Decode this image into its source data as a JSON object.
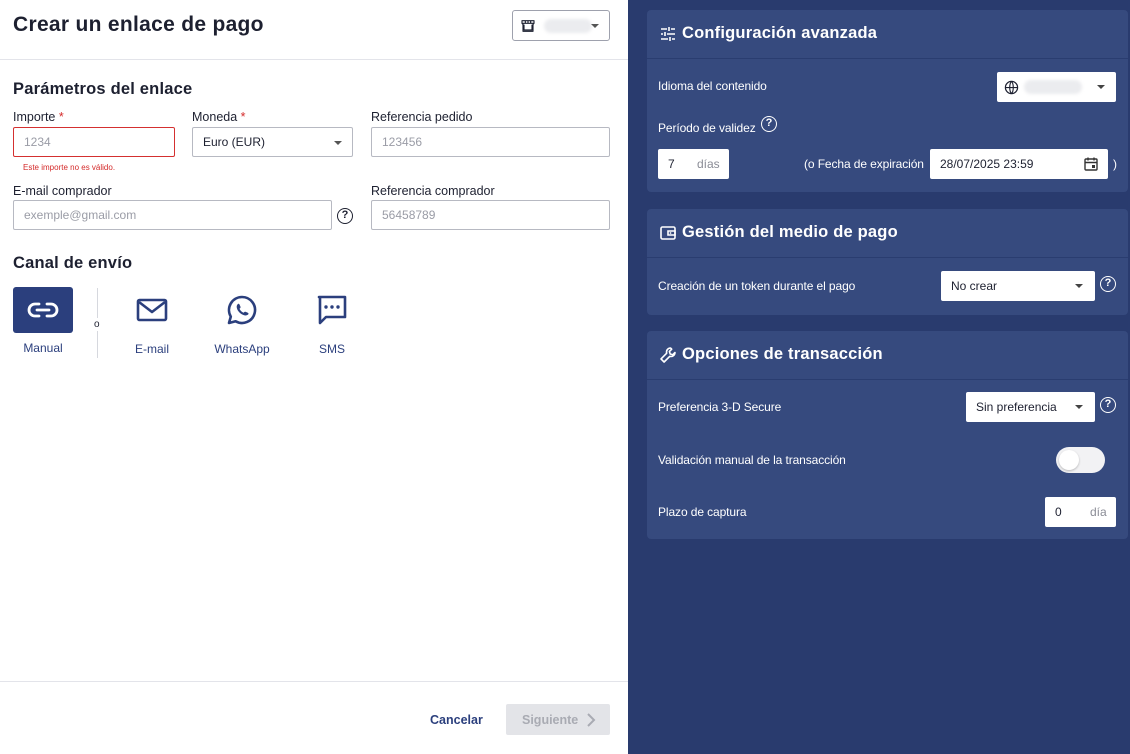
{
  "header": {
    "title": "Crear un enlace de pago",
    "shop_selector_value": "••••"
  },
  "params": {
    "title": "Parámetros del enlace",
    "amount": {
      "label": "Importe",
      "required": "*",
      "placeholder": "1234",
      "error": "Este importe no es válido."
    },
    "currency": {
      "label": "Moneda",
      "required": "*",
      "value": "Euro (EUR)"
    },
    "order_ref": {
      "label": "Referencia pedido",
      "placeholder": "123456"
    },
    "email": {
      "label": "E-mail comprador",
      "placeholder": "exemple@gmail.com"
    },
    "buyer_ref": {
      "label": "Referencia comprador",
      "placeholder": "56458789"
    }
  },
  "channels": {
    "title": "Canal de envío",
    "or_text": "o",
    "items": [
      {
        "label": "Manual",
        "icon": "link-icon",
        "active": true
      },
      {
        "label": "E-mail",
        "icon": "mail-icon",
        "active": false
      },
      {
        "label": "WhatsApp",
        "icon": "whatsapp-icon",
        "active": false
      },
      {
        "label": "SMS",
        "icon": "sms-icon",
        "active": false
      }
    ]
  },
  "footer": {
    "cancel": "Cancelar",
    "next": "Siguiente"
  },
  "advanced": {
    "title": "Configuración avanzada",
    "language_label": "Idioma del contenido",
    "language_value": "••••••",
    "validity_label": "Período de validez",
    "validity_days": "7",
    "days_unit": "días",
    "expiry_label": "(o Fecha de expiración",
    "expiry_value": "28/07/2025 23:59",
    "close_paren": ")"
  },
  "payment_method": {
    "title": "Gestión del medio de pago",
    "token_label": "Creación de un token durante el pago",
    "token_value": "No crear"
  },
  "transaction": {
    "title": "Opciones de transacción",
    "secure_label": "Preferencia 3-D Secure",
    "secure_value": "Sin preferencia",
    "manual_validation_label": "Validación manual de la transacción",
    "manual_validation_on": false,
    "capture_label": "Plazo de captura",
    "capture_value": "0",
    "capture_unit": "día"
  },
  "colors": {
    "primary": "#2b3f7d",
    "right_panel": "#293b6e",
    "card": "#364a7e",
    "error": "#d42a2a"
  }
}
